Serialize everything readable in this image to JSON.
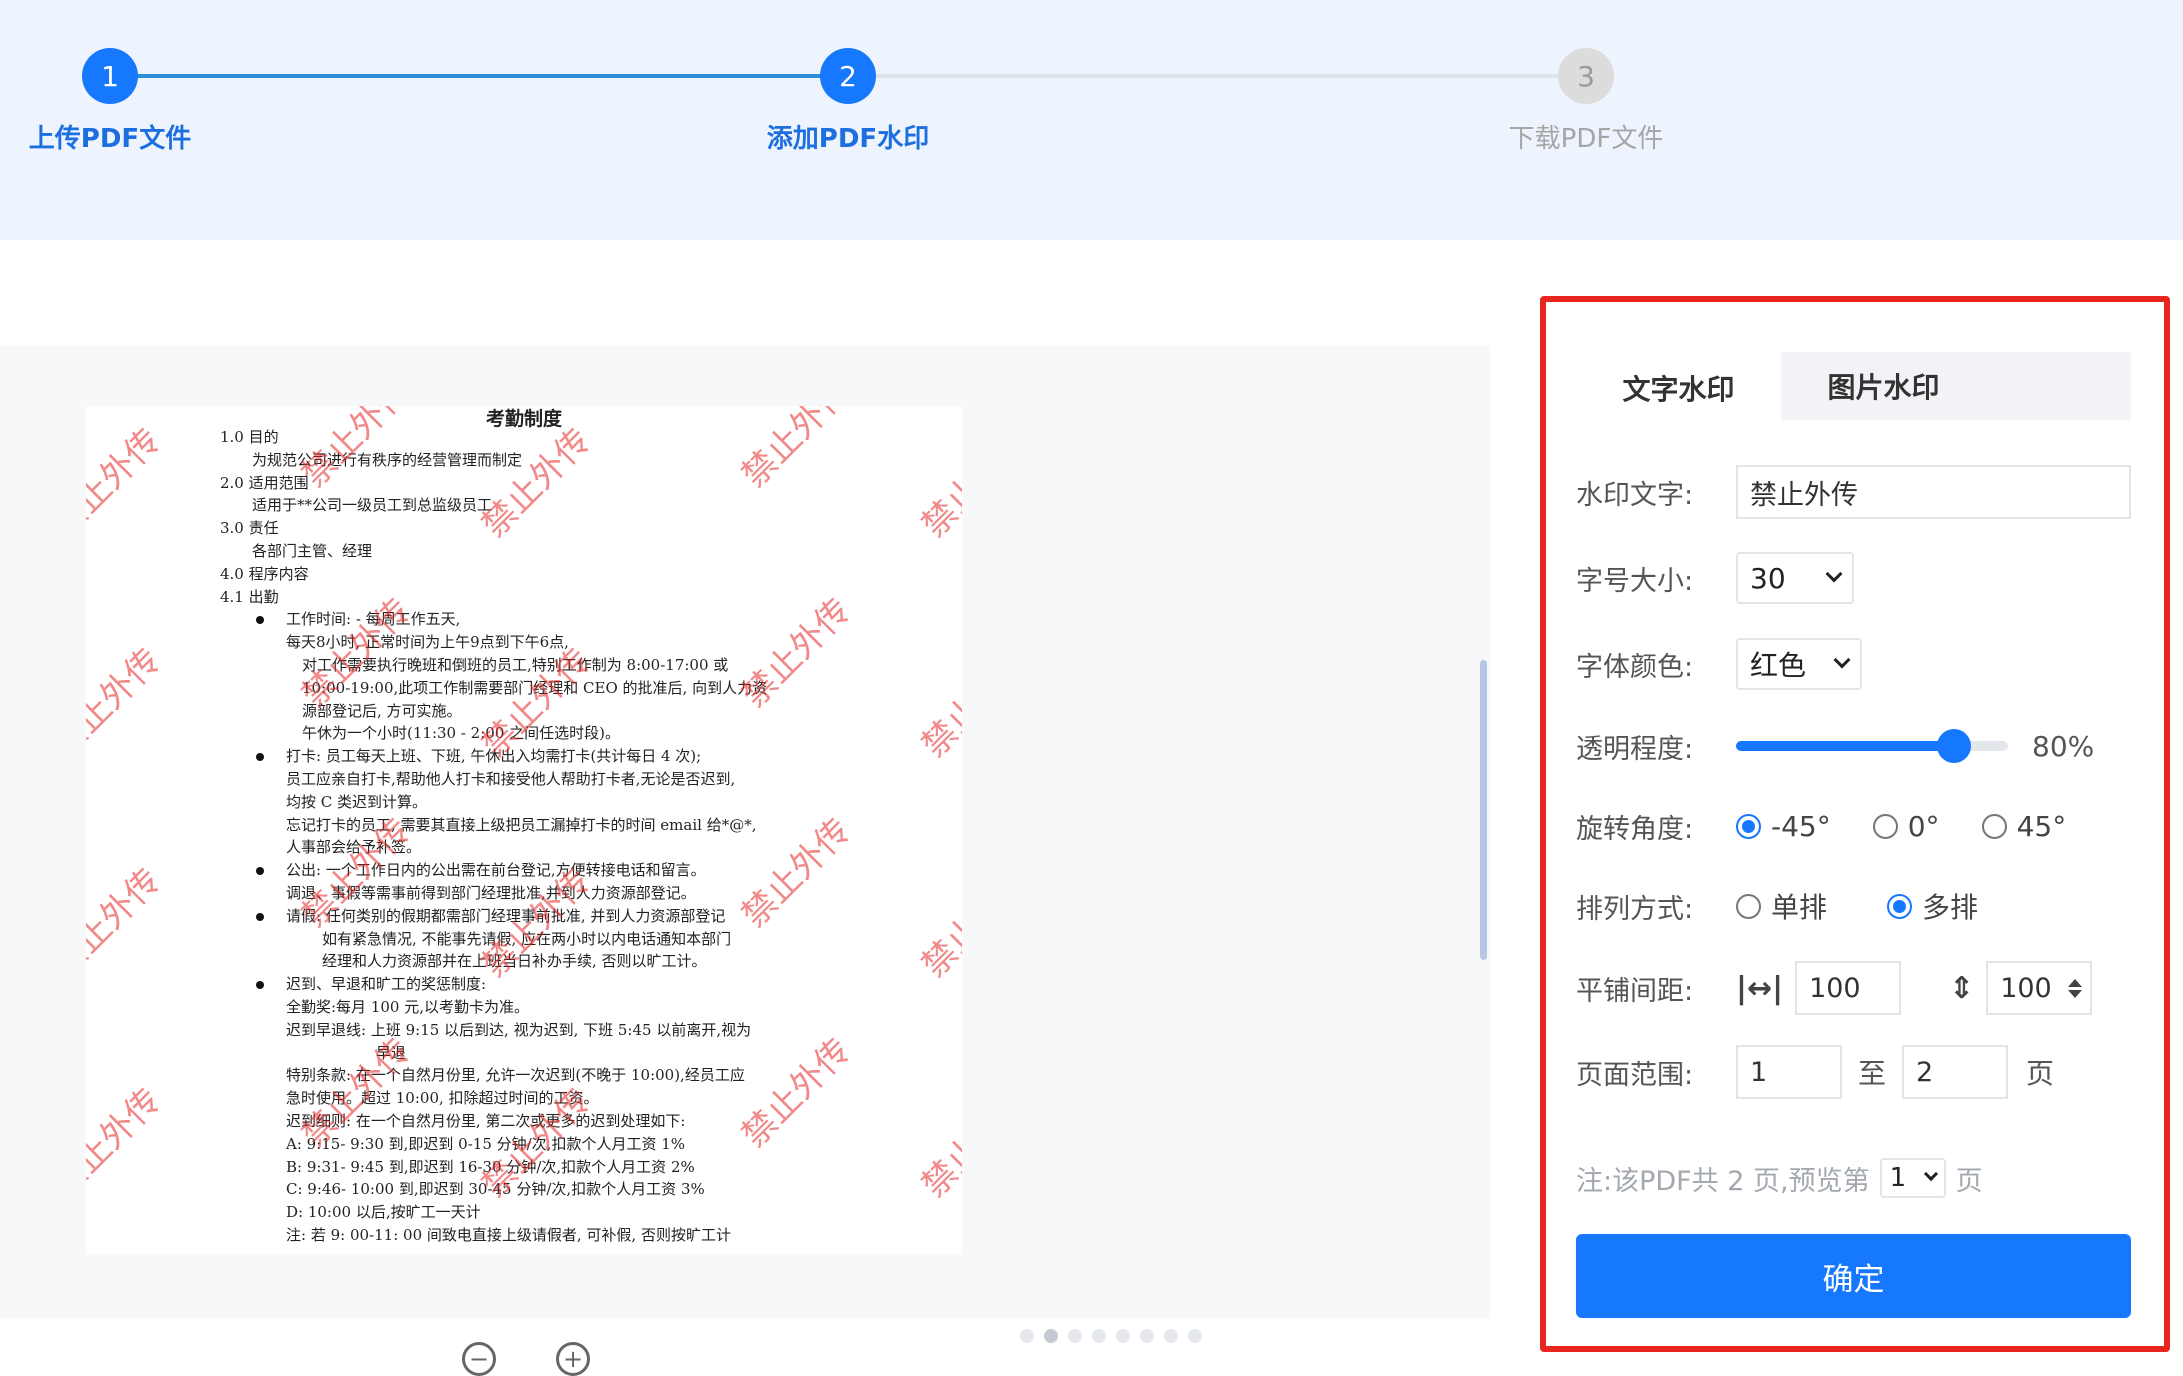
{
  "steps": [
    {
      "number": "1",
      "label": "上传PDF文件",
      "state": "done"
    },
    {
      "number": "2",
      "label": "添加PDF水印",
      "state": "active"
    },
    {
      "number": "3",
      "label": "下载PDF文件",
      "state": "todo"
    }
  ],
  "colors": {
    "accent": "#1677ff",
    "panel_border": "#e8261f",
    "watermark": "#e62828"
  },
  "preview": {
    "watermark_text": "禁止外传",
    "document": {
      "title": "考勤制度",
      "lines": [
        "1.0  目的",
        "为规范公司进行有秩序的经营管理而制定",
        "2.0  适用范围",
        "适用于**公司一级员工到总监级员工",
        "3.0  责任",
        "各部门主管、经理",
        "4.0  程序内容",
        "4.1  出勤",
        "工作时间: - 每周工作五天,",
        "每天8小时, 正常时间为上午9点到下午6点,",
        "对工作需要执行晚班和倒班的员工,特别工作制为 8:00-17:00 或",
        "10:00-19:00,此项工作制需要部门经理和 CEO 的批准后, 向到人力资",
        "源部登记后, 方可实施。",
        "午休为一个小时(11:30 - 2:00 之间任选时段)。",
        "打卡: 员工每天上班、下班, 午休出入均需打卡(共计每日 4 次);",
        "员工应亲自打卡,帮助他人打卡和接受他人帮助打卡者,无论是否迟到,",
        "均按 C 类迟到计算。",
        "忘记打卡的员工, 需要其直接上级把员工漏掉打卡的时间 email 给*@*,",
        "人事部会给予补签。",
        "公出: 一个工作日内的公出需在前台登记,方便转接电话和留言。",
        "调退、事假等需事前得到部门经理批准,并到人力资源部登记。",
        "请假: 任何类别的假期都需部门经理事前批准, 并到人力资源部登记",
        "如有紧急情况, 不能事先请假, 应在两小时以内电话通知本部门",
        "经理和人力资源部并在上班当日补办手续, 否则以旷工计。",
        "迟到、早退和旷工的奖惩制度:",
        "全勤奖:每月 100 元,以考勤卡为准。",
        "迟到早退线: 上班 9:15 以后到达, 视为迟到, 下班 5:45 以前离开,视为",
        "早退",
        "特别条款: 在一个自然月份里, 允许一次迟到(不晚于 10:00),经员工应",
        "急时使用。超过 10:00, 扣除超过时间的工资。",
        "迟到细则: 在一个自然月份里, 第二次或更多的迟到处理如下:",
        "A: 9:15- 9:30 到,即迟到 0-15 分钟/次,扣款个人月工资 1%",
        "B: 9:31- 9:45 到,即迟到 16-30 分钟/次,扣款个人月工资 2%",
        "C: 9:46- 10:00 到,即迟到 30-45 分钟/次,扣款个人月工资 3%",
        "D: 10:00 以后,按旷工一天计",
        "注: 若 9: 00-11: 00 间致电直接上级请假者, 可补假, 否则按旷工计"
      ]
    },
    "zoom_out": "−",
    "zoom_in": "+"
  },
  "panel": {
    "tabs": [
      {
        "label": "文字水印",
        "active": true
      },
      {
        "label": "图片水印",
        "active": false
      }
    ],
    "watermark_text_label": "水印文字:",
    "watermark_text_value": "禁止外传",
    "font_size_label": "字号大小:",
    "font_size_value": "30",
    "font_color_label": "字体颜色:",
    "font_color_value": "红色",
    "opacity_label": "透明程度:",
    "opacity_percent": 80,
    "opacity_text": "80%",
    "rotation_label": "旋转角度:",
    "rotation_options": [
      {
        "label": "-45°",
        "selected": true
      },
      {
        "label": "0°",
        "selected": false
      },
      {
        "label": "45°",
        "selected": false
      }
    ],
    "layout_label": "排列方式:",
    "layout_options": [
      {
        "label": "单排",
        "selected": false
      },
      {
        "label": "多排",
        "selected": true
      }
    ],
    "spacing_label": "平铺间距:",
    "spacing_h": "100",
    "spacing_v": "100",
    "range_label": "页面范围:",
    "range_from": "1",
    "range_to_word": "至",
    "range_to": "2",
    "range_page_word": "页",
    "note_prefix": "注:该PDF共 2 页,预览第",
    "note_page_value": "1",
    "note_suffix": "页",
    "confirm_label": "确定"
  }
}
